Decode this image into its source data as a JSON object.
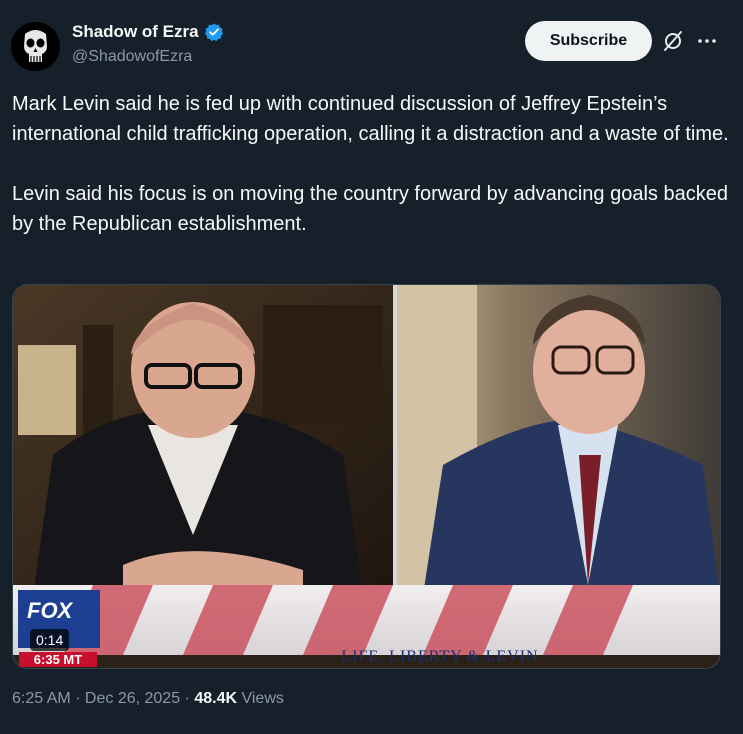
{
  "author": {
    "display_name": "Shadow of Ezra",
    "handle": "@ShadowofEzra",
    "verified": true,
    "avatar_icon": "punisher-skull-icon"
  },
  "actions": {
    "subscribe_label": "Subscribe",
    "grok_icon": "grok-icon",
    "more_icon": "more-options-icon"
  },
  "post": {
    "text": "Mark Levin said he is fed up with continued discussion of Jeffrey Epstein’s international child trafficking operation, calling it a distraction and a waste of time.\n\nLevin said his focus is on moving the country forward by advancing goals backed by the Republican establishment."
  },
  "media": {
    "duration": "0:14",
    "chyron_show": "LIFE, LIBERTY & LEVIN",
    "fox_time": "6:35 MT",
    "fox_logo": "FOX"
  },
  "meta": {
    "time": "6:25 AM",
    "date": "Dec 26, 2025",
    "views_count": "48.4K",
    "views_label": "Views"
  },
  "colors": {
    "background": "#15202b",
    "accent_verified": "#1d9bf0",
    "secondary_text": "#8b98a5"
  }
}
